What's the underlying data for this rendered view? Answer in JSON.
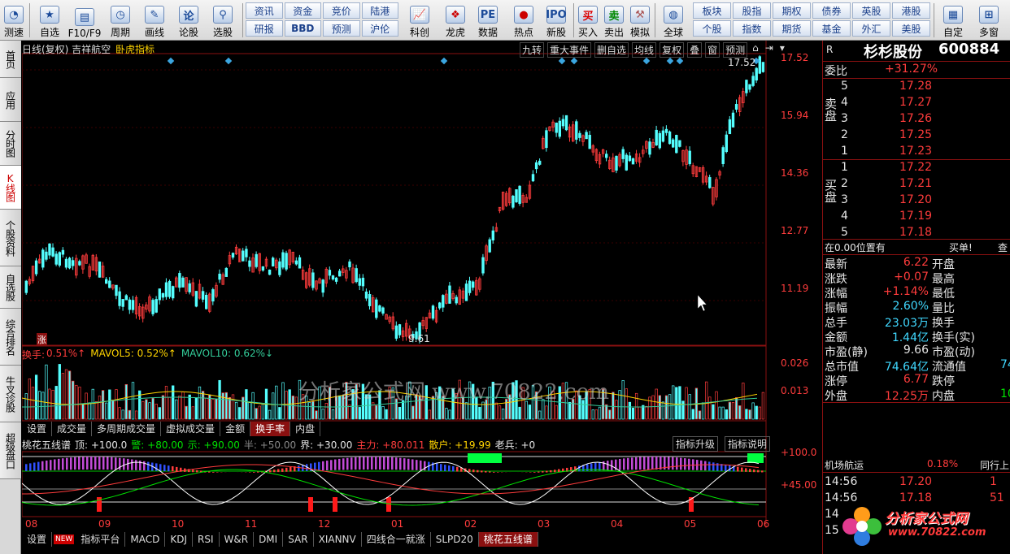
{
  "toolbar": {
    "buttons": [
      {
        "label": "测速",
        "icon": "gauge-icon"
      },
      {
        "label": "自选",
        "icon": "star-icon"
      },
      {
        "label": "F10/F9",
        "icon": "doc-icon"
      },
      {
        "label": "周期",
        "icon": "clock-icon"
      },
      {
        "label": "画线",
        "icon": "pen-icon"
      },
      {
        "label": "论股",
        "icon": "discuss-icon"
      },
      {
        "label": "选股",
        "icon": "select-icon"
      },
      {
        "label": "科创",
        "icon": "chart-icon"
      },
      {
        "label": "龙虎",
        "icon": "dragon-icon"
      },
      {
        "label": "数据",
        "icon": "data-icon"
      },
      {
        "label": "热点",
        "icon": "hot-icon"
      },
      {
        "label": "新股",
        "icon": "newstock-icon"
      },
      {
        "label": "买入",
        "icon": "buy-icon"
      },
      {
        "label": "卖出",
        "icon": "sell-icon"
      },
      {
        "label": "模拟",
        "icon": "hammer-icon"
      },
      {
        "label": "全球",
        "icon": "globe-icon"
      },
      {
        "label": "自定",
        "icon": "custom-icon"
      },
      {
        "label": "多窗",
        "icon": "window-icon"
      }
    ],
    "grid1": [
      "资讯",
      "资金",
      "研报",
      "BBD",
      "竞价",
      "陆港",
      "预测",
      "沪伦"
    ],
    "grid2": [
      "板块",
      "股指",
      "期权",
      "债券",
      "英股",
      "港股",
      "个股",
      "指数",
      "期货",
      "基金",
      "外汇",
      "美股"
    ]
  },
  "left_tabs": [
    "首页",
    "应用",
    "分时图",
    "K线图",
    "个股资料",
    "自选股",
    "综合排名",
    "牛叉诊股",
    "超级盘口"
  ],
  "chart": {
    "title": "日线(复权) 吉祥航空",
    "indicator": "卧虎指标",
    "top_buttons": [
      "九转",
      "重大事件",
      "删自选",
      "均线",
      "复权",
      "叠",
      "窗",
      "预测"
    ],
    "price_axis": [
      "17.52",
      "15.94",
      "14.36",
      "12.77",
      "11.19"
    ],
    "high_label": "17.52",
    "low_label": "9.61",
    "zhang_label": "涨",
    "turnover_legend": {
      "name": "换手:",
      "val": "0.51%↑",
      "ma5": "MAVOL5: 0.52%↑",
      "ma10": "MAVOL10: 0.62%↓"
    },
    "turnover_axis": [
      "0.026",
      "0.013"
    ],
    "sub_tabs": [
      "设置",
      "成交量",
      "多周期成交量",
      "虚拟成交量",
      "金额",
      "换手率",
      "内盘"
    ],
    "sub_tab_selected": "换手率",
    "peach_legend": [
      {
        "text": "桃花五线谱",
        "color": "#e6e6e6"
      },
      {
        "text": "顶: +100.0",
        "color": "#e6e6e6"
      },
      {
        "text": "警: +80.00",
        "color": "#00e000"
      },
      {
        "text": "示: +90.00",
        "color": "#00e000"
      },
      {
        "text": "半: +50.00",
        "color": "#888888"
      },
      {
        "text": "界: +30.00",
        "color": "#e6e6e6"
      },
      {
        "text": "主力: +80.011",
        "color": "#ff3c3c"
      },
      {
        "text": "散户: +19.99",
        "color": "#ffd400"
      },
      {
        "text": "老兵: +0",
        "color": "#e6e6e6"
      }
    ],
    "peach_buttons": [
      "指标升级",
      "指标说明"
    ],
    "peach_axis": [
      "+100.0",
      "+45.00"
    ],
    "months": [
      "08",
      "09",
      "10",
      "11",
      "12",
      "01",
      "02",
      "03",
      "04",
      "05",
      "06"
    ],
    "bottom_tabs": [
      "设置",
      "NEW",
      "指标平台",
      "MACD",
      "KDJ",
      "RSI",
      "W&R",
      "DMI",
      "SAR",
      "XIANNV",
      "四线合一就涨",
      "SLPD20",
      "桃花五线谱"
    ],
    "bottom_tab_selected": "桃花五线谱",
    "watermark": "分析家公式网 www.70822.com"
  },
  "quote": {
    "name": "杉杉股份",
    "code": "600884",
    "r_label": "R",
    "wei_bi": {
      "label": "委比",
      "value": "+31.27%"
    },
    "sell_label": "卖盘",
    "buy_label": "买盘",
    "sells": [
      {
        "n": "5",
        "price": "17.28"
      },
      {
        "n": "4",
        "price": "17.27"
      },
      {
        "n": "3",
        "price": "17.26"
      },
      {
        "n": "2",
        "price": "17.25"
      },
      {
        "n": "1",
        "price": "17.23"
      }
    ],
    "buys": [
      {
        "n": "1",
        "price": "17.22"
      },
      {
        "n": "2",
        "price": "17.21"
      },
      {
        "n": "3",
        "price": "17.20"
      },
      {
        "n": "4",
        "price": "17.19"
      },
      {
        "n": "5",
        "price": "17.18"
      }
    ],
    "position_line": {
      "left": "在0.00位置有",
      "mid": "买单!",
      "right": "查"
    },
    "stats": [
      {
        "k1": "最新",
        "v1": "6.22",
        "k2": "开盘"
      },
      {
        "k1": "涨跌",
        "v1": "+0.07",
        "k2": "最高"
      },
      {
        "k1": "涨幅",
        "v1": "+1.14%",
        "k2": "最低"
      },
      {
        "k1": "振幅",
        "v1": "2.60%",
        "k2": "量比"
      },
      {
        "k1": "总手",
        "v1": "23.03万",
        "k2": "换手"
      },
      {
        "k1": "金额",
        "v1": "1.44亿",
        "k2": "换手(实)"
      },
      {
        "k1": "市盈(静)",
        "v1": "9.66",
        "k2": "市盈(动)"
      },
      {
        "k1": "总市值",
        "v1": "74.64亿",
        "k2": "流通值",
        "v2": "74"
      },
      {
        "k1": "涨停",
        "v1": "6.77",
        "k2": "跌停"
      },
      {
        "k1": "外盘",
        "v1": "12.25万",
        "k2": "内盘",
        "v2": "10"
      }
    ],
    "sector": {
      "name": "机场航运",
      "change": "0.18%",
      "more": "同行上"
    },
    "ticks": [
      {
        "time": "14:56",
        "price": "17.20",
        "vol": "1"
      },
      {
        "time": "14:56",
        "price": "17.18",
        "vol": "51"
      },
      {
        "time": "14",
        "price": "",
        "vol": ""
      },
      {
        "time": "15",
        "price": "",
        "vol": ""
      }
    ],
    "logo_text": "分析家公式网",
    "logo_url": "www.70822.com"
  }
}
